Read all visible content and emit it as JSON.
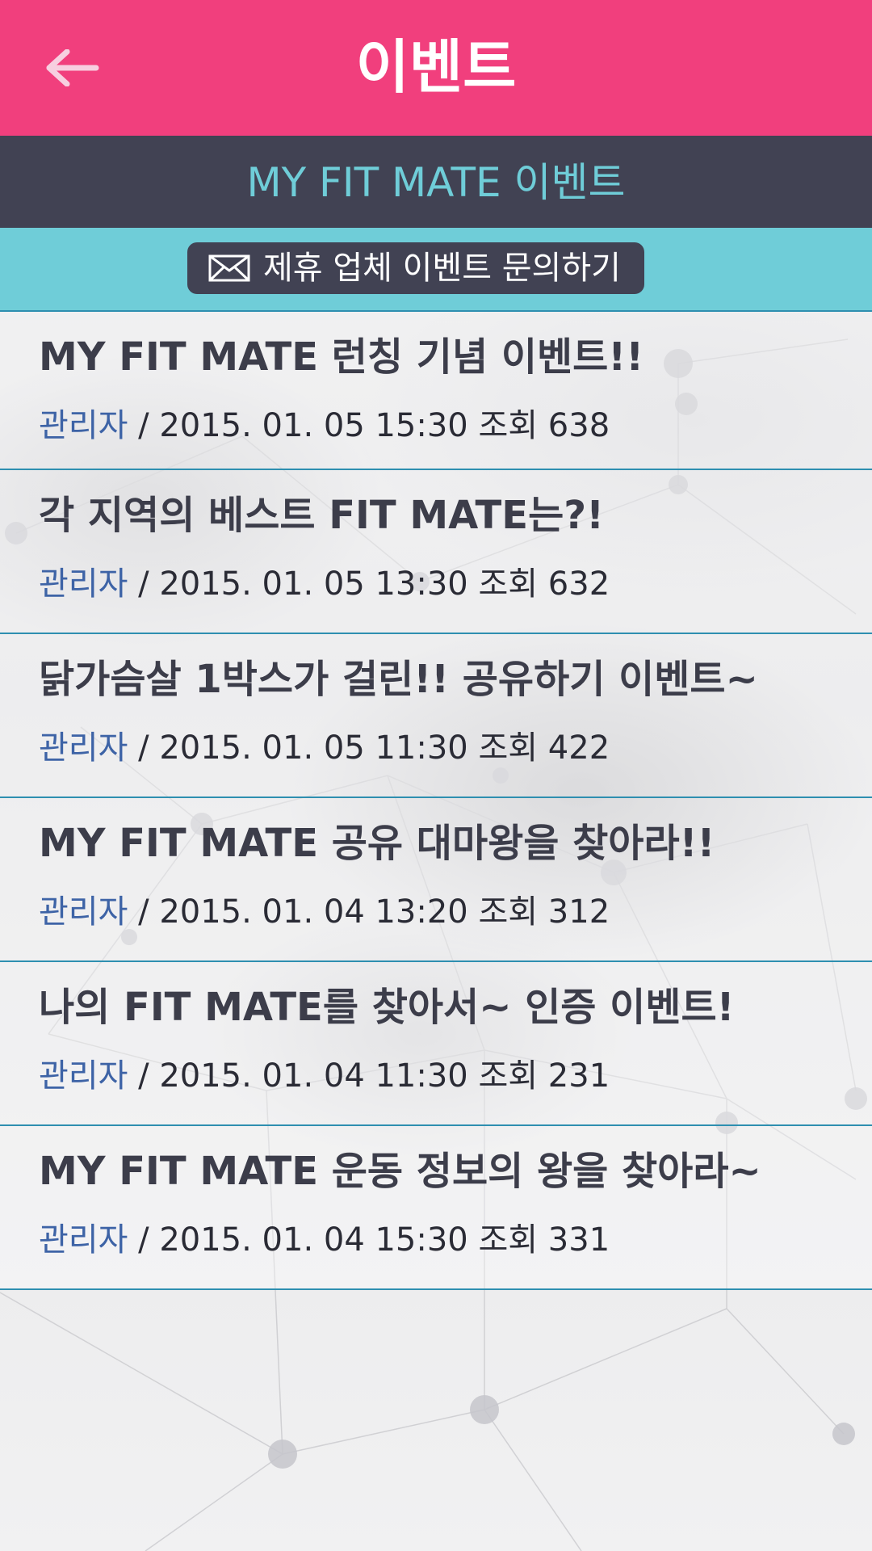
{
  "header": {
    "title": "이벤트",
    "back_icon": "arrow-left-icon",
    "background_color": "#f13f7d"
  },
  "subheader": {
    "title": "MY FIT MATE 이벤트",
    "background_color": "#414253",
    "text_color": "#6fcdd8"
  },
  "inquiry": {
    "icon": "envelope-icon",
    "label": "제휴 업체 이벤트 문의하기",
    "bar_color": "#6fcdd8"
  },
  "events": [
    {
      "title": "MY FIT MATE 런칭 기념 이벤트!!",
      "author": "관리자",
      "separator": " / ",
      "datetime": "2015. 01. 05 15:30",
      "views": "조회 638"
    },
    {
      "title": "각 지역의 베스트 FIT MATE는?!",
      "author": "관리자",
      "separator": " / ",
      "datetime": "2015. 01. 05 13:30",
      "views": "조회 632"
    },
    {
      "title": "닭가슴살 1박스가 걸린!! 공유하기 이벤트~",
      "author": "관리자",
      "separator": " / ",
      "datetime": "2015. 01. 05 11:30",
      "views": "조회 422"
    },
    {
      "title": "MY FIT MATE 공유 대마왕을 찾아라!!",
      "author": "관리자",
      "separator": " / ",
      "datetime": "2015. 01. 04 13:20",
      "views": "조회 312"
    },
    {
      "title": "나의 FIT MATE를 찾아서~ 인증 이벤트!",
      "author": "관리자",
      "separator": " / ",
      "datetime": "2015. 01. 04 11:30",
      "views": "조회 231"
    },
    {
      "title": "MY FIT MATE 운동 정보의 왕을 찾아라~",
      "author": "관리자",
      "separator": " / ",
      "datetime": "2015. 01. 04 15:30",
      "views": "조회 331"
    }
  ],
  "colors": {
    "author": "#3d63a6",
    "divider": "#2e8fb0",
    "title_text": "#3c3d4a"
  }
}
